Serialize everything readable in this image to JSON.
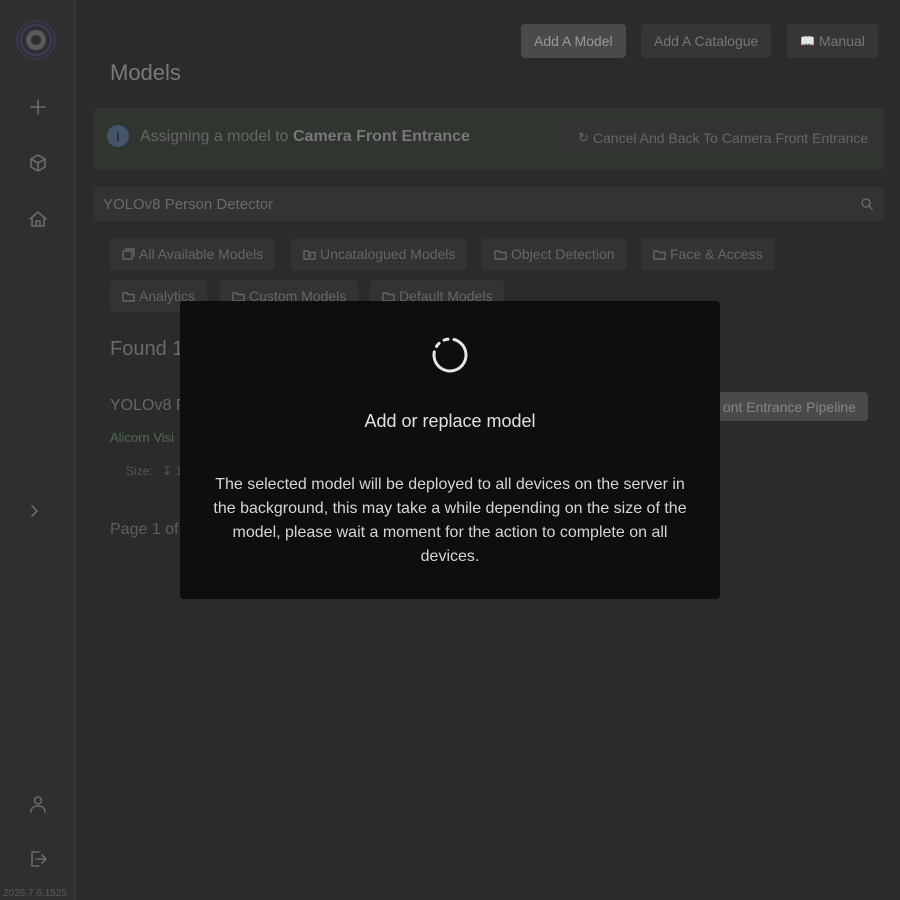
{
  "sidebar": {
    "version": "2026.7.6.1525",
    "icons": [
      "add-icon",
      "cube-icon",
      "home-icon",
      "chevron-right-icon",
      "user-icon",
      "logout-icon"
    ]
  },
  "header": {
    "add_model": "Add A Model",
    "add_catalogue": "Add A Catalogue",
    "manual": "Manual",
    "title": "Models"
  },
  "alert": {
    "prefix": "Assigning a model to ",
    "camera": "Camera Front Entrance",
    "cancel": "Cancel And Back To Camera Front Entrance"
  },
  "search": {
    "value": "YOLOv8 Person Detector"
  },
  "catalogues": [
    "All Available Models",
    "Uncatalogued Models",
    "Object Detection",
    "Face & Access",
    "Analytics",
    "Custom Models",
    "Default Models"
  ],
  "results": {
    "found": "Found 1",
    "model_name": "YOLOv8 Pe",
    "vendor": "Alicorn Visi",
    "size_label": "Size:",
    "size_value": "1",
    "pipeline": "ont Entrance Pipeline",
    "page": "Page 1 of"
  },
  "modal": {
    "title": "Add or replace model",
    "body": "The selected model will be deployed to all devices on the server in the background, this may take a while depending on the size of the model, please wait a moment for the action to complete on all devices."
  },
  "colors": {
    "background": "#2b2b2b",
    "modal_bg": "#0e0e0e",
    "vendor_green": "#4f6b4f",
    "info_blue": "#45546a"
  }
}
